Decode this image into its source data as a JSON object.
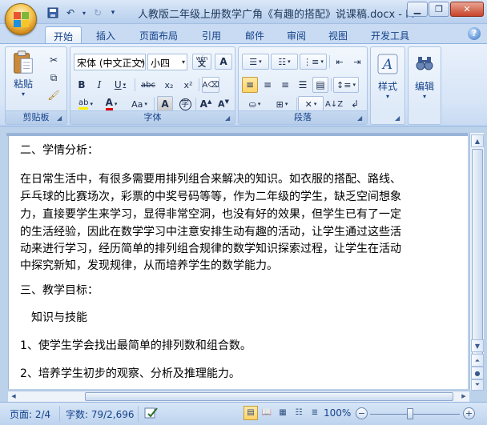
{
  "window": {
    "title": "人教版二年级上册数学广角《有趣的搭配》说课稿.docx - M"
  },
  "tabs": [
    {
      "label": "开始"
    },
    {
      "label": "插入"
    },
    {
      "label": "页面布局"
    },
    {
      "label": "引用"
    },
    {
      "label": "邮件"
    },
    {
      "label": "审阅"
    },
    {
      "label": "视图"
    },
    {
      "label": "开发工具"
    }
  ],
  "ribbon": {
    "clipboard": {
      "label": "剪贴板",
      "paste_label": "粘贴"
    },
    "font": {
      "label": "字体",
      "font_name": "宋体 (中文正文)",
      "font_size": "小四",
      "wen": "wén"
    },
    "paragraph": {
      "label": "段落"
    },
    "styles": {
      "label": "样式"
    },
    "editing": {
      "label": "编辑"
    }
  },
  "document": {
    "lines": [
      "二、学情分析：",
      "在日常生活中，有很多需要用排列组合来解决的知识。如衣服的搭配、路线、",
      "乒乓球的比赛场次，彩票的中奖号码等等，作为二年级的学生，缺乏空间想象",
      "力，直接要学生来学习，显得非常空洞，也没有好的效果，但学生已有了一定",
      "的生活经验，因此在数学学习中注意安排生动有趣的活动，让学生通过这些活",
      "动来进行学习，经历简单的排列组合规律的数学知识探索过程，让学生在活动",
      "中探究新知，发现规律，从而培养学生的数学能力。",
      "三、教学目标：",
      "知识与技能",
      "1、使学生学会找出最简单的排列数和组合数。",
      "2、培养学生初步的观察、分析及推理能力。"
    ]
  },
  "status": {
    "page": "页面: 2/4",
    "words": "字数: 79/2,696",
    "zoom": "100%"
  }
}
